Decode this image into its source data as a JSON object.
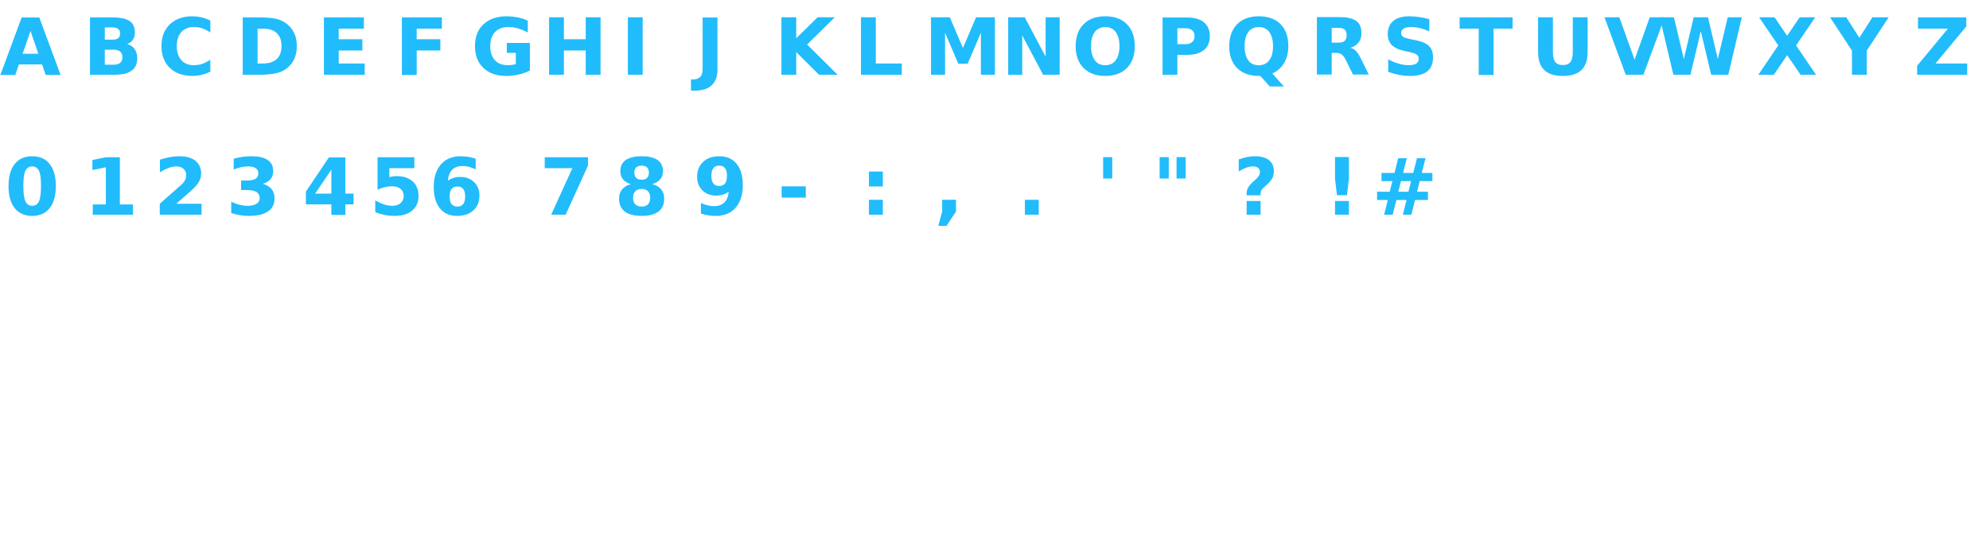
{
  "glyph_color": "#21bcfb",
  "rows": {
    "letters": [
      "A",
      "B",
      "C",
      "D",
      "E",
      "F",
      "G",
      "H",
      "I",
      "J",
      "K",
      "L",
      "M",
      "N",
      "O",
      "P",
      "Q",
      "R",
      "S",
      "T",
      "U",
      "V",
      "W",
      "X",
      "Y",
      "Z"
    ],
    "symbols": [
      "0",
      "1",
      "2",
      "3",
      "4",
      "5",
      "6",
      "7",
      "8",
      "9",
      "-",
      ":",
      ",",
      ".",
      "'",
      "\"",
      "?",
      "!",
      "#"
    ]
  }
}
